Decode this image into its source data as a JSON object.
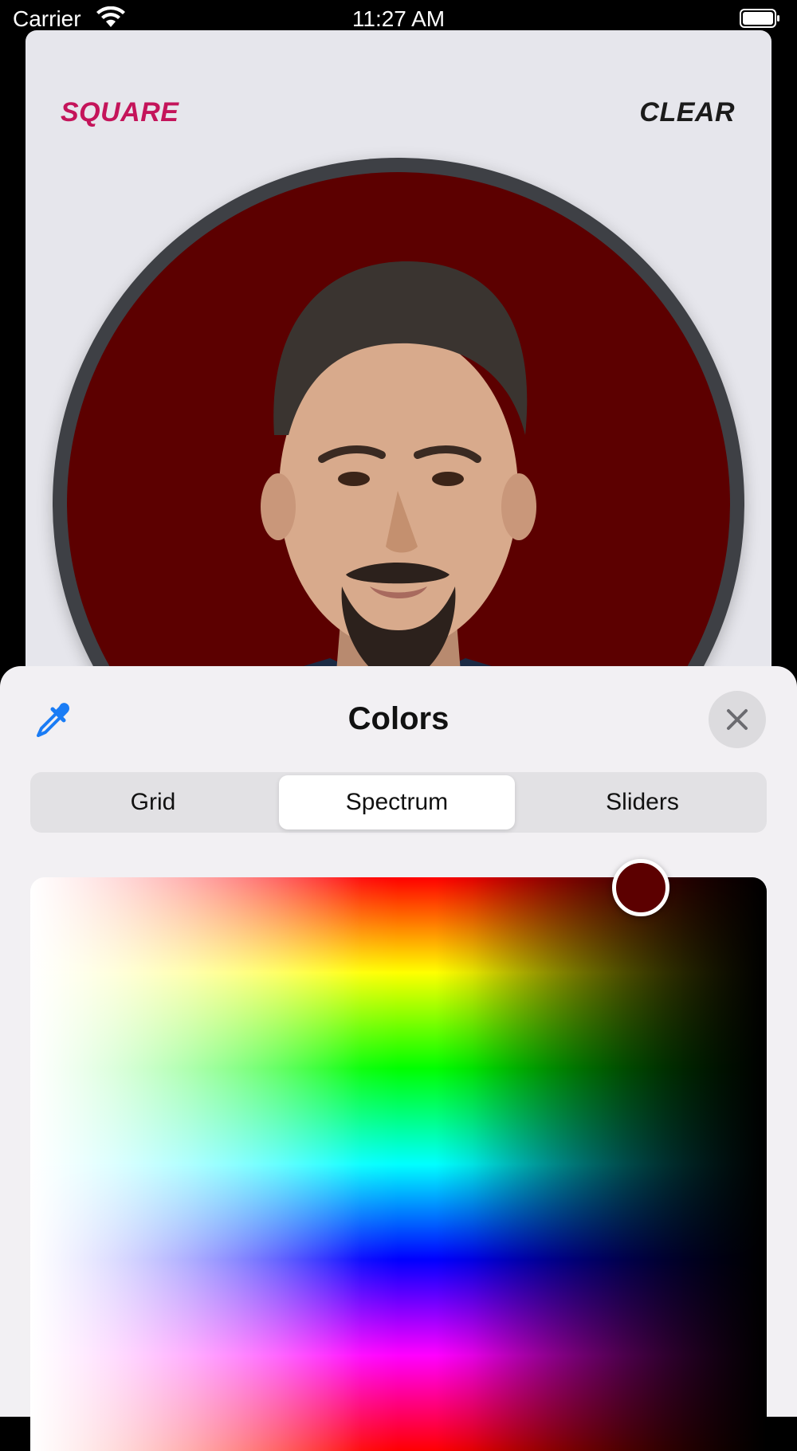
{
  "status_bar": {
    "carrier": "Carrier",
    "time": "11:27 AM"
  },
  "toolbar": {
    "square_label": "SQUARE",
    "clear_label": "CLEAR",
    "square_color": "#c4145a"
  },
  "avatar": {
    "background_color": "#5c0000",
    "ring_color": "#3e4045"
  },
  "color_picker": {
    "title": "Colors",
    "tabs": [
      {
        "label": "Grid",
        "selected": false
      },
      {
        "label": "Spectrum",
        "selected": true
      },
      {
        "label": "Sliders",
        "selected": false
      }
    ],
    "selected_color": "#5c0000",
    "icons": {
      "eyedropper": "eyedropper-icon",
      "close": "close-icon"
    }
  }
}
